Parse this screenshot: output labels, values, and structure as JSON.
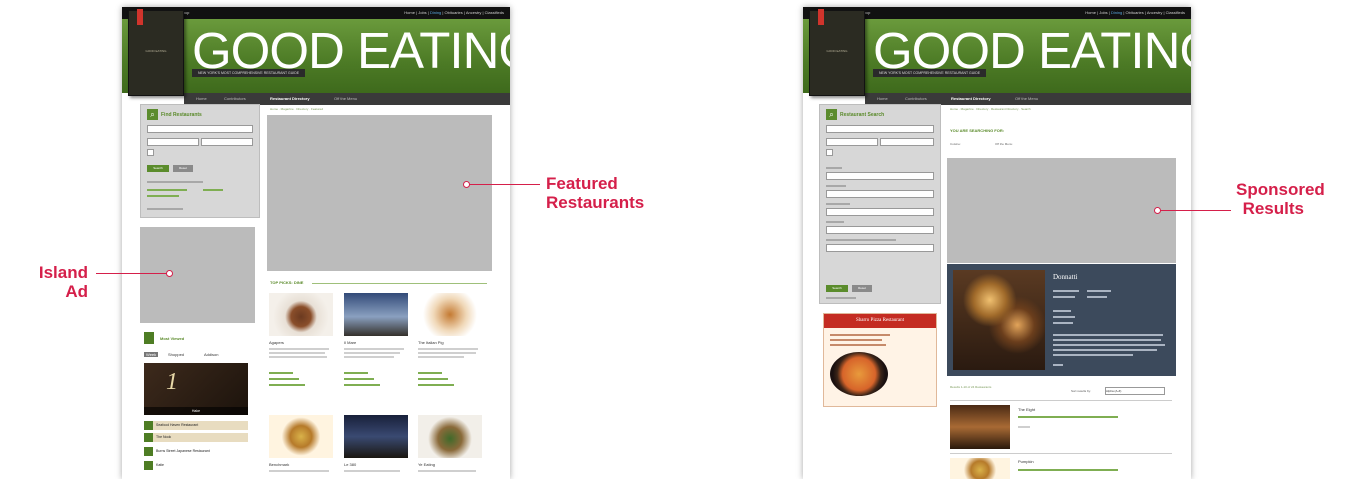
{
  "topbar": {
    "left": "Subscribe  |  ✉ Good Eating Signup",
    "right_links": [
      "Home",
      "Jobs"
    ],
    "right_active": "Dining",
    "right_links_after": [
      "Obituaries",
      "Ancestry",
      "Classifieds"
    ]
  },
  "header": {
    "logo": "GOOD EATING",
    "tagline": "NEW YORK'S MOST COMPREHENSIVE RESTAURANT GUIDE",
    "book_spine": "GOOD EATING",
    "nav": [
      "Home",
      "Contributors",
      "Restaurant Directory",
      "Off the Menu"
    ],
    "nav_active_index": 2
  },
  "page1": {
    "search_title": "Find Restaurants",
    "search_placeholder": "Type search to browse",
    "select_1": "Any Location",
    "select_2": "Any Cuisine",
    "checkbox_label": "Late-Night Eats",
    "search_btn": "Search",
    "reset_btn": "Reset",
    "browse_label": "Popular Searches:",
    "more_link": "Search tips »",
    "breadcrumb": "Home · Magazine · Directory · Featured",
    "top_picks_title": "TOP PICKS: DINE",
    "cards_row1": [
      "Agapers",
      "Il Mare",
      "The Italian Pig"
    ],
    "cards_row2": [
      "Benchmark",
      "Le 380",
      "Ye Eating"
    ],
    "most_viewed_title": "Most Viewed",
    "tabs": [
      "Week",
      "Shopped",
      "Addison"
    ],
    "tab_active": 0,
    "rank_items": [
      "Seafood Haven Restaurant",
      "The Nook",
      "Burns Street Japanese Restaurant",
      "Katie"
    ],
    "rank_number": "1",
    "rank_caption": "Hake"
  },
  "page2": {
    "search_title": "Restaurant Search",
    "search_placeholder": "Type search to browse",
    "select_1": "Any Location",
    "select_2": "Any Cuisine",
    "checkbox_label": "Late-Night Eats",
    "filters": [
      "Price",
      "Cuisine",
      "Meal Time",
      "Attire"
    ],
    "search_btn": "Search",
    "reset_btn": "Reset",
    "breadcrumb": "Home · Magazine · Directory · Restaurant Directory · Search",
    "results_title": "YOU ARE SEARCHING FOR:",
    "query_label": "Cuisine:",
    "query_value": "Off the Menu",
    "feature_name": "Donnatti",
    "ad_title": "Sbarro Pizza Restaurant",
    "results_count": "Results 1-10 of 24 Restaurants",
    "sort_label": "Sort results by:",
    "sort_value": "Alpha (A-Z)",
    "result_1": "The Eight",
    "result_2": "Pumpkin"
  },
  "callouts": {
    "featured": "Featured\nRestaurants",
    "island": "Island\nAd",
    "sponsored": "Sponsored\nResults"
  },
  "colors": {
    "accent": "#d51f4a",
    "brand_green": "#5b8c2c",
    "placeholder_grey": "#bbbbbb"
  }
}
